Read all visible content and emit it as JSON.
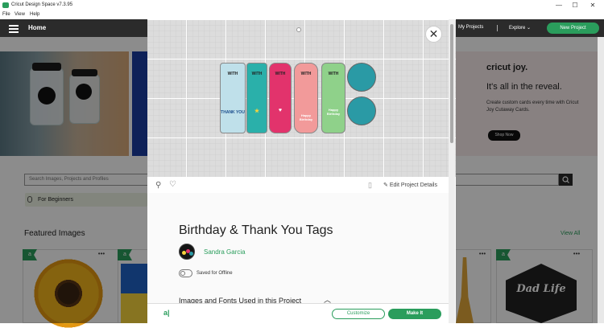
{
  "window": {
    "title": "Cricut Design Space  v7.3.95",
    "minimize": "—",
    "maximize": "☐",
    "close": "✕"
  },
  "menu": [
    "File",
    "View",
    "Help"
  ],
  "nav": {
    "home": "Home",
    "my_projects": "My Projects",
    "explore": "Explore",
    "new_project": "New Project"
  },
  "banner": {
    "brand": "cricut joy.",
    "headline": "It's all in the reveal.",
    "subtext": "Create custom cards every time with Cricut Joy Cutaway Cards.",
    "cta": "Shop Now"
  },
  "search": {
    "placeholder": "Search Images, Projects and Profiles"
  },
  "chip": {
    "label": "For Beginners"
  },
  "featured": {
    "title": "Featured Images",
    "view_all": "View All",
    "card_flag": "a",
    "card_more": "•••",
    "dadlife": "Dad Life"
  },
  "modal": {
    "close": "✕",
    "edit_details": "Edit Project Details",
    "project_title": "Birthday & Thank You Tags",
    "author": "Sandra Garcia",
    "saved_offline": "Saved for Offline",
    "images_fonts": "Images and Fonts Used in this Project",
    "footer_logo": "a|",
    "customize": "Customize",
    "make_it": "Make It",
    "tags": [
      {
        "text_top": "WITH",
        "text_bottom": "THANK YOU",
        "color": "#bfe0ea"
      },
      {
        "text_top": "WITH",
        "text_bottom": "★",
        "color": "#2ab0aa"
      },
      {
        "text_top": "WITH",
        "text_bottom": "♥",
        "color": "#e2336c"
      },
      {
        "text_top": "WITH",
        "text_bottom": "Happy Birthday",
        "color": "#f29a9a"
      },
      {
        "text_top": "WITH",
        "text_bottom": "Happy Birthday",
        "color": "#8fd18a"
      },
      {
        "text_top": "",
        "text_bottom": "",
        "color": "#2a9aa5"
      }
    ]
  },
  "colors": {
    "accent": "#2a9d5c",
    "nav_bg": "#2b2b2b"
  }
}
